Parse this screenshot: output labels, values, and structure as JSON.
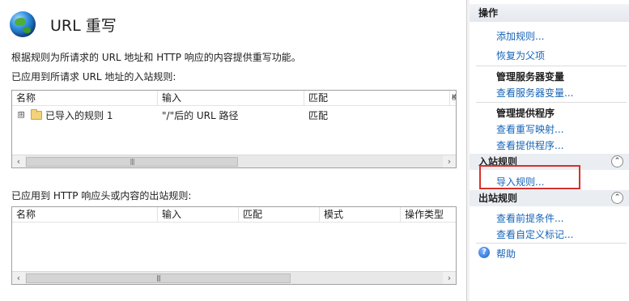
{
  "main": {
    "title": "URL 重写",
    "description": "根据规则为所请求的 URL 地址和 HTTP 响应的内容提供重写功能。",
    "inbound": {
      "label": "已应用到所请求 URL 地址的入站规则:",
      "columns": [
        "名称",
        "输入",
        "匹配",
        "模"
      ],
      "rows": [
        {
          "expander": "⊞",
          "name": "已导入的规则 1",
          "input": "\"/\"后的 URL 路径",
          "match": "匹配"
        }
      ]
    },
    "outbound": {
      "label": "已应用到 HTTP 响应头或内容的出站规则:",
      "columns": [
        "名称",
        "输入",
        "匹配",
        "模式",
        "操作类型"
      ]
    },
    "scroll": {
      "left_arrow": "‹",
      "right_arrow": "›",
      "thumb_grip": "|||"
    }
  },
  "actions": {
    "header": "操作",
    "links_top": [
      "添加规则...",
      "恢复为父项"
    ],
    "server_vars_title": "管理服务器变量",
    "server_vars_link": "查看服务器变量...",
    "providers_title": "管理提供程序",
    "providers_links": [
      "查看重写映射...",
      "查看提供程序..."
    ],
    "inbound_title": "入站规则",
    "inbound_link": "导入规则...",
    "outbound_title": "出站规则",
    "outbound_links": [
      "查看前提条件...",
      "查看自定义标记..."
    ],
    "help": "帮助",
    "collapse_glyph": "⌃",
    "help_glyph": "?"
  },
  "colors": {
    "link": "#1564b8",
    "highlight": "#d9302a",
    "section_bg": "#eaedf2"
  }
}
